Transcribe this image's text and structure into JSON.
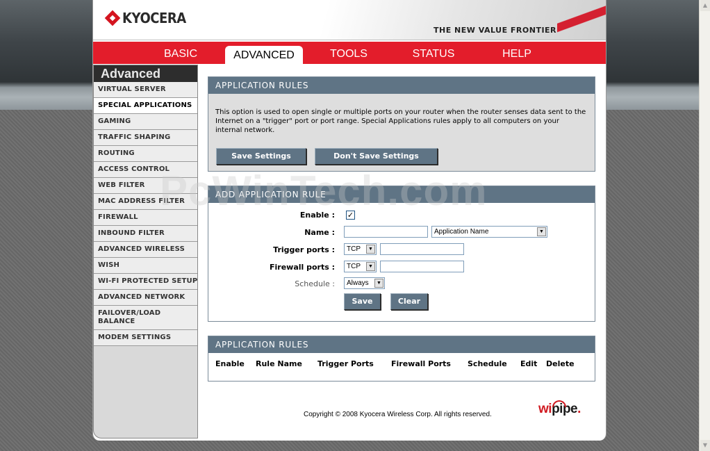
{
  "header": {
    "brand": "KYOCERA",
    "tagline": "THE NEW VALUE FRONTIER"
  },
  "nav": {
    "tabs": [
      {
        "label": "BASIC",
        "active": false
      },
      {
        "label": "ADVANCED",
        "active": true
      },
      {
        "label": "TOOLS",
        "active": false
      },
      {
        "label": "STATUS",
        "active": false
      },
      {
        "label": "HELP",
        "active": false
      }
    ]
  },
  "sidebar": {
    "title": "Advanced",
    "items": [
      {
        "label": "VIRTUAL SERVER"
      },
      {
        "label": "SPECIAL APPLICATIONS",
        "active": true
      },
      {
        "label": "GAMING"
      },
      {
        "label": "TRAFFIC SHAPING"
      },
      {
        "label": "ROUTING"
      },
      {
        "label": "ACCESS CONTROL"
      },
      {
        "label": "WEB FILTER"
      },
      {
        "label": "MAC ADDRESS FILTER"
      },
      {
        "label": "FIREWALL"
      },
      {
        "label": "INBOUND FILTER"
      },
      {
        "label": "ADVANCED WIRELESS"
      },
      {
        "label": "WISH"
      },
      {
        "label": "WI-FI PROTECTED SETUP"
      },
      {
        "label": "ADVANCED NETWORK"
      },
      {
        "label": "FAILOVER/LOAD BALANCE"
      },
      {
        "label": "MODEM SETTINGS"
      }
    ]
  },
  "app_rules_intro": {
    "title": "APPLICATION RULES",
    "description": "This option is used to open single or multiple ports on your router when the router senses data sent to the Internet on a \"trigger\" port or port range. Special Applications rules apply to all computers on your internal network.",
    "save_label": "Save Settings",
    "dont_save_label": "Don't Save Settings"
  },
  "add_rule": {
    "title": "ADD APPLICATION RULE",
    "enable_label": "Enable :",
    "enable_checked": "✓",
    "name_label": "Name :",
    "name_value": "",
    "app_name_select": "Application Name",
    "trigger_label": "Trigger ports :",
    "trigger_protocol": "TCP",
    "trigger_value": "",
    "firewall_label": "Firewall ports :",
    "firewall_protocol": "TCP",
    "firewall_value": "",
    "schedule_label": "Schedule :",
    "schedule_value": "Always",
    "save_label": "Save",
    "clear_label": "Clear"
  },
  "rules_table": {
    "title": "APPLICATION RULES",
    "columns": [
      "Enable",
      "Rule Name",
      "Trigger Ports",
      "Firewall Ports",
      "Schedule",
      "Edit",
      "Delete"
    ]
  },
  "footer": {
    "copyright": "Copyright © 2008 Kyocera Wireless Corp. All rights reserved.",
    "logo_text_a": "wi",
    "logo_text_b": "pipe",
    "logo_text_c": "."
  },
  "watermark": "PcWinTech.com",
  "colors": {
    "nav_red": "#e31d2b",
    "section_header": "#5f7485",
    "brand_red": "#d4141f"
  }
}
